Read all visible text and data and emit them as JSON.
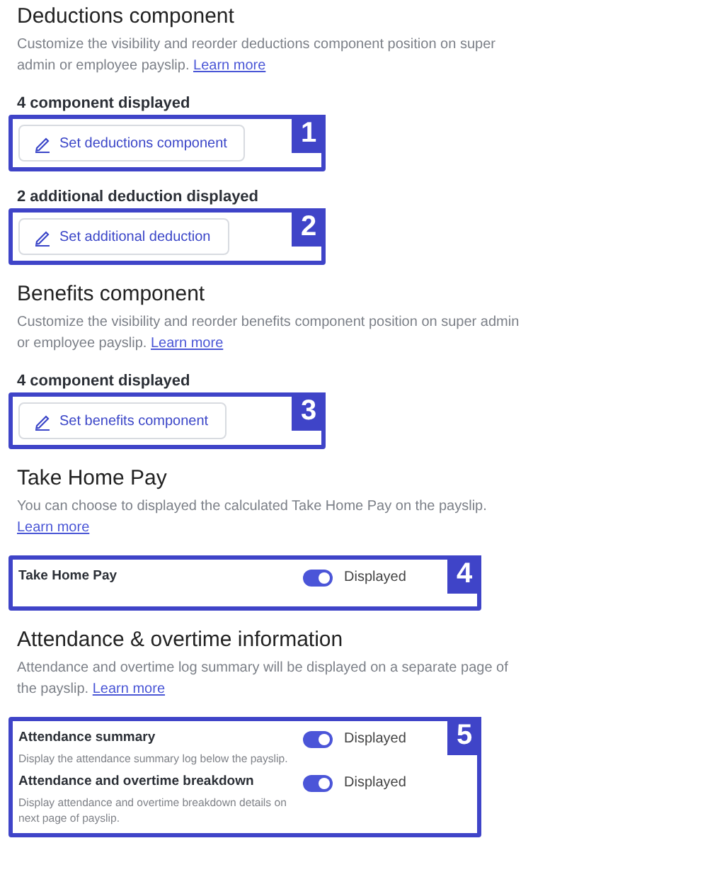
{
  "sections": [
    {
      "title": "Deductions component",
      "description": "Customize the visibility and reorder deductions component position on super admin or employee payslip.",
      "link": "Learn more",
      "controls": [
        {
          "kind": "button",
          "caption": "4 component displayed",
          "label": "Set deductions component",
          "marker": "1"
        },
        {
          "kind": "button",
          "caption": "2 additional deduction displayed",
          "label": "Set additional deduction",
          "marker": "2"
        }
      ]
    },
    {
      "title": "Benefits component",
      "description": "Customize the visibility and reorder benefits component position on super admin or employee payslip.",
      "link": "Learn more",
      "controls": [
        {
          "kind": "button",
          "caption": "4 component displayed",
          "label": "Set benefits component",
          "marker": "3"
        }
      ]
    },
    {
      "title": "Take Home Pay",
      "description": "You can choose to displayed the calculated Take Home Pay on the payslip.",
      "link": "Learn more",
      "controls": [
        {
          "kind": "toggles",
          "marker": "4",
          "rows": [
            {
              "title": "Take Home Pay",
              "on": true,
              "status": "Displayed"
            }
          ]
        }
      ]
    },
    {
      "title": "Attendance & overtime information",
      "description": "Attendance and overtime log summary will be displayed on a separate page of the payslip.",
      "link": "Learn more",
      "controls": [
        {
          "kind": "toggles",
          "marker": "5",
          "rows": [
            {
              "title": "Attendance summary",
              "hint": "Display the attendance summary log below the payslip.",
              "on": true,
              "status": "Displayed"
            },
            {
              "title": "Attendance and overtime breakdown",
              "hint": "Display attendance and overtime breakdown details on next page of payslip.",
              "on": true,
              "status": "Displayed"
            }
          ]
        }
      ]
    }
  ]
}
